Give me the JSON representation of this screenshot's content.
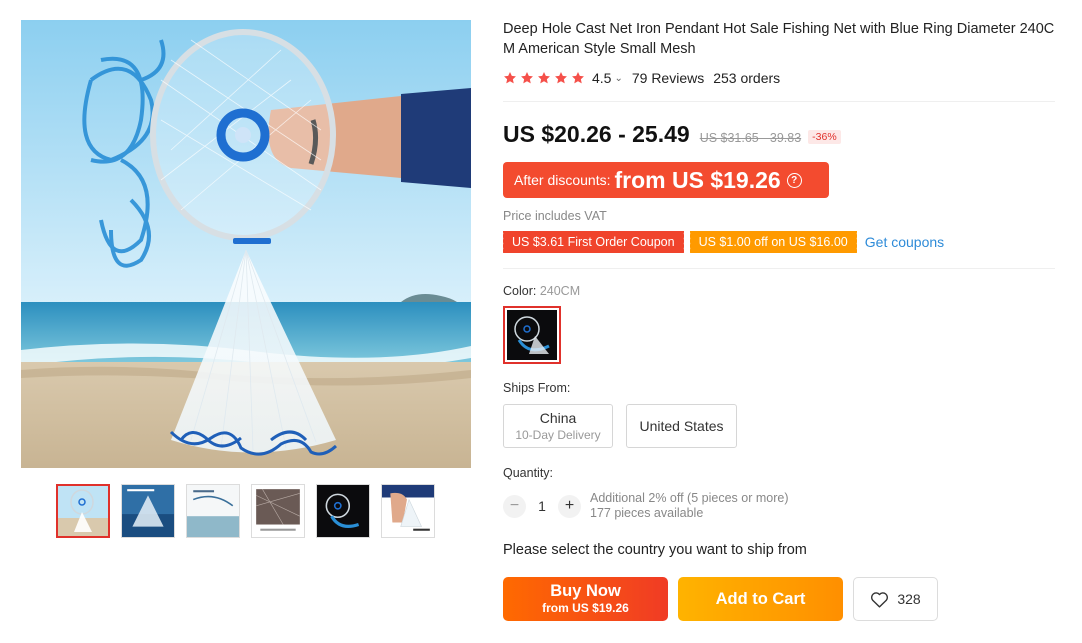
{
  "product": {
    "title": "Deep Hole Cast Net Iron Pendant Hot Sale Fishing Net with Blue Ring Diameter 240CM American Style Small Mesh",
    "rating": "4.5",
    "rating_caret": "⌄",
    "reviews": "79 Reviews",
    "orders": "253 orders"
  },
  "pricing": {
    "price": "US $20.26 - 25.49",
    "original": "US $31.65 - 39.83",
    "discount": "-36%",
    "after_label": "After discounts:",
    "after_price": "from US $19.26",
    "after_help": "?",
    "vat_note": "Price includes VAT"
  },
  "coupons": {
    "first_order": "US $3.61 First Order Coupon",
    "threshold": "US $1.00 off on US $16.00",
    "get_link": "Get coupons"
  },
  "color": {
    "label": "Color:",
    "selected": "240CM"
  },
  "shipping": {
    "label": "Ships From:",
    "options": [
      {
        "name": "China",
        "sub": "10-Day Delivery"
      },
      {
        "name": "United States"
      }
    ]
  },
  "quantity": {
    "label": "Quantity:",
    "minus": "−",
    "value": "1",
    "plus": "+",
    "discount_note": "Additional 2% off (5 pieces or more)",
    "available": "177 pieces available"
  },
  "ship_note": "Please select the country you want to ship from",
  "actions": {
    "buy_now": "Buy Now",
    "buy_now_sub": "from US $19.26",
    "add_to_cart": "Add to Cart",
    "wishlist_count": "328"
  },
  "gallery": {
    "thumbnail_count": 6,
    "active_index": 0
  },
  "colors": {
    "accent_red": "#e0312b",
    "star": "#f5504a",
    "coupon_orange": "#ff9a00",
    "link_blue": "#2e8bd8"
  }
}
